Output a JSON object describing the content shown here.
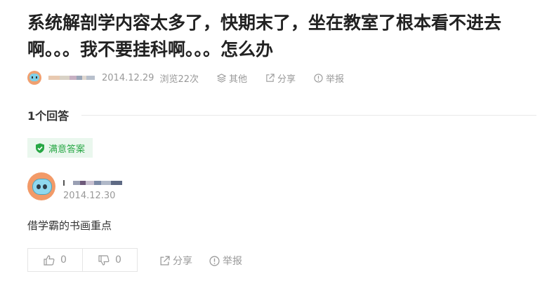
{
  "question": {
    "title": "系统解剖学内容太多了，快期末了，坐在教室了根本看不进去啊。。。我不要挂科啊。。。怎么办",
    "date": "2014.12.29",
    "views": "浏览22次",
    "actions": {
      "more": "其他",
      "share": "分享",
      "report": "举报"
    }
  },
  "answers": {
    "count_label": "1个回答",
    "best_label": "满意答案",
    "items": [
      {
        "date": "2014.12.30",
        "body": "借学霸的书画重点",
        "upvotes": "0",
        "downvotes": "0",
        "share": "分享",
        "report": "举报"
      }
    ]
  },
  "colors": {
    "accent_green": "#28a745",
    "badge_bg": "#eaf7ee",
    "muted_text": "#999999"
  },
  "icons": [
    "avatar",
    "layers-icon",
    "share-icon",
    "report-icon",
    "shield-check-icon",
    "thumbs-up-icon",
    "thumbs-down-icon"
  ]
}
